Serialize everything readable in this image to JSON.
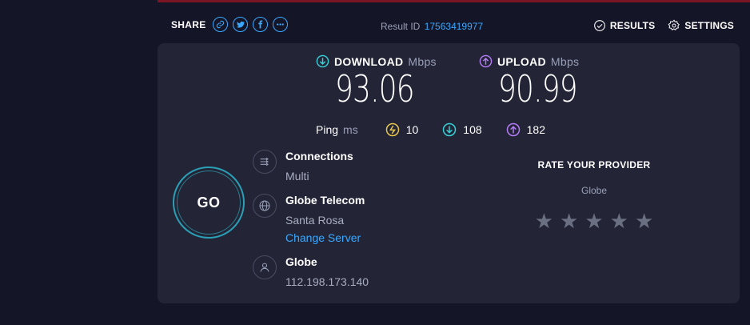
{
  "share": {
    "label": "SHARE",
    "icons": [
      "link-icon",
      "twitter-icon",
      "facebook-icon",
      "more-icon"
    ]
  },
  "result": {
    "label": "Result ID",
    "id": "17563419977"
  },
  "top_actions": {
    "results": "RESULTS",
    "settings": "SETTINGS"
  },
  "download": {
    "label": "DOWNLOAD",
    "unit": "Mbps",
    "value": "93.06"
  },
  "upload": {
    "label": "UPLOAD",
    "unit": "Mbps",
    "value": "90.99"
  },
  "ping": {
    "label": "Ping",
    "unit": "ms",
    "idle": "10",
    "download": "108",
    "upload": "182"
  },
  "go": {
    "label": "GO"
  },
  "connections": {
    "title": "Connections",
    "value": "Multi"
  },
  "server": {
    "title": "Globe Telecom",
    "location": "Santa Rosa",
    "change": "Change Server"
  },
  "isp": {
    "title": "Globe",
    "ip": "112.198.173.140"
  },
  "rate": {
    "title": "RATE YOUR PROVIDER",
    "provider": "Globe",
    "stars": 5
  },
  "colors": {
    "background": "#141526",
    "panel": "#232537",
    "accent": "#3aa8ff",
    "download": "#36d0d6",
    "upload": "#b67cf7",
    "idle": "#e8c64b",
    "star": "#6b6f82"
  }
}
